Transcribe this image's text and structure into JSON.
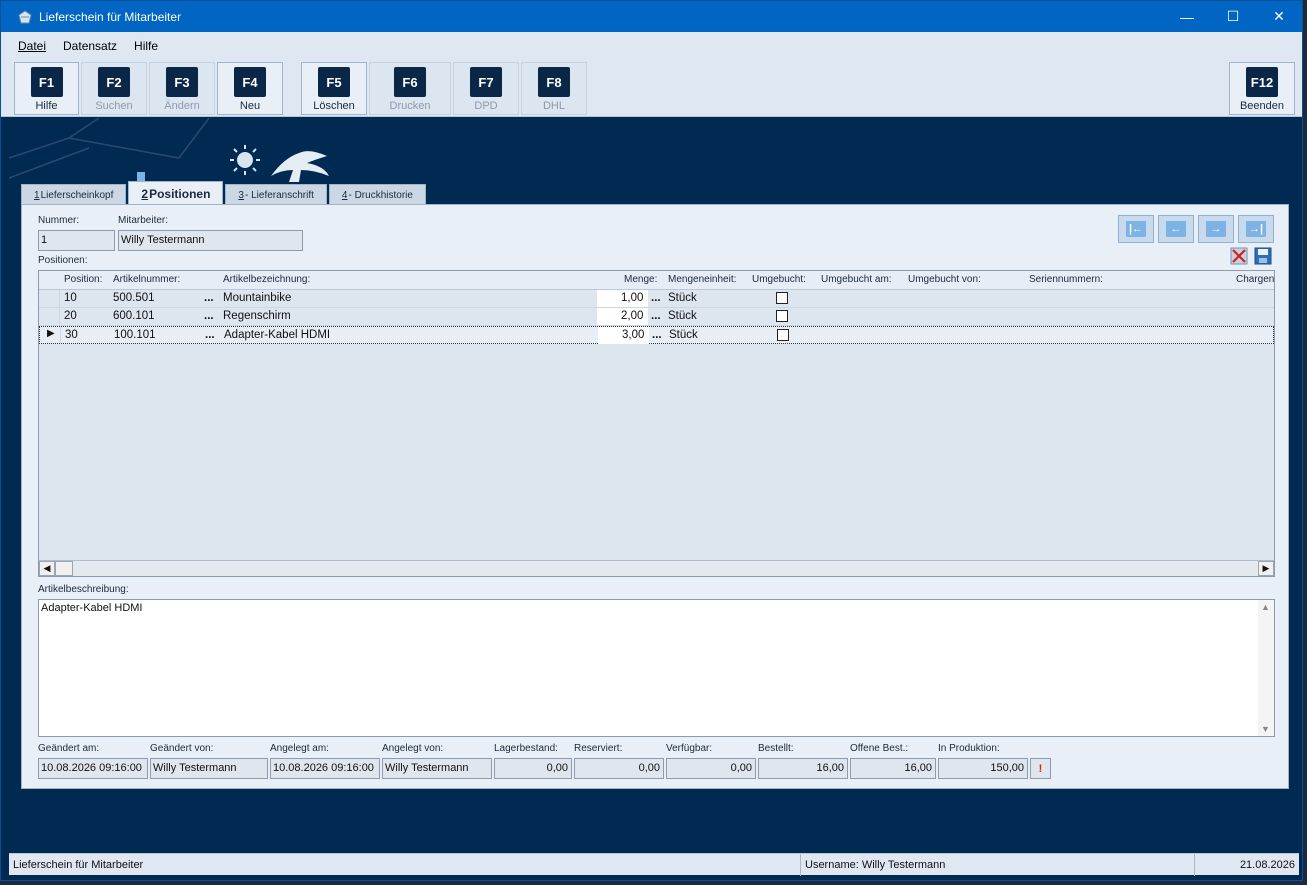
{
  "window": {
    "title": "Lieferschein für Mitarbeiter"
  },
  "menu": [
    "Datei",
    "Datensatz",
    "Hilfe"
  ],
  "fkeys": [
    {
      "key": "F1",
      "label": "Hilfe"
    },
    {
      "key": "F2",
      "label": "Suchen"
    },
    {
      "key": "F3",
      "label": "Ändern"
    },
    {
      "key": "F4",
      "label": "Neu"
    },
    {
      "key": "F5",
      "label": "Löschen"
    },
    {
      "key": "F6",
      "label": "Drucken"
    },
    {
      "key": "F7",
      "label": "DPD"
    },
    {
      "key": "F8",
      "label": "DHL"
    },
    {
      "key": "F12",
      "label": "Beenden"
    }
  ],
  "tabs": [
    {
      "num": "1",
      "label": " Lieferscheinkopf"
    },
    {
      "num": "2",
      "label": " Positionen"
    },
    {
      "num": "3",
      "label": " - Lieferanschrift"
    },
    {
      "num": "4",
      "label": " - Druckhistorie"
    }
  ],
  "header": {
    "nummer_label": "Nummer:",
    "nummer": "1",
    "mitarbeiter_label": "Mitarbeiter:",
    "mitarbeiter": "Willy Testermann",
    "positionen_label": "Positionen:"
  },
  "grid": {
    "columns": [
      "Position:",
      "Artikelnummer:",
      "Artikelbezeichnung:",
      "Menge:",
      "Mengeneinheit:",
      "Umgebucht:",
      "Umgebucht am:",
      "Umgebucht von:",
      "Seriennummern:",
      "Chargen"
    ],
    "rows": [
      {
        "pos": "10",
        "artnr": "500.501",
        "bez": "Mountainbike",
        "menge": "1,00",
        "einheit": "Stück"
      },
      {
        "pos": "20",
        "artnr": "600.101",
        "bez": "Regenschirm",
        "menge": "2,00",
        "einheit": "Stück"
      },
      {
        "pos": "30",
        "artnr": "100.101",
        "bez": "Adapter-Kabel HDMI",
        "menge": "3,00",
        "einheit": "Stück"
      }
    ],
    "ellipsis": "..."
  },
  "description": {
    "label": "Artikelbeschreibung:",
    "text": "Adapter-Kabel HDMI"
  },
  "footer": {
    "geaendert_am_label": "Geändert am:",
    "geaendert_am": "10.08.2026 09:16:00",
    "geaendert_von_label": "Geändert von:",
    "geaendert_von": "Willy Testermann",
    "angelegt_am_label": "Angelegt am:",
    "angelegt_am": "10.08.2026 09:16:00",
    "angelegt_von_label": "Angelegt von:",
    "angelegt_von": "Willy Testermann",
    "lagerbestand_label": "Lagerbestand:",
    "lagerbestand": "0,00",
    "reserviert_label": "Reserviert:",
    "reserviert": "0,00",
    "verfuegbar_label": "Verfügbar:",
    "verfuegbar": "0,00",
    "bestellt_label": "Bestellt:",
    "bestellt": "16,00",
    "offene_label": "Offene Best.:",
    "offene": "16,00",
    "produktion_label": "In Produktion:",
    "produktion": "150,00",
    "excl": "!"
  },
  "status": {
    "left": "Lieferschein für Mitarbeiter",
    "user": "Username: Willy Testermann",
    "date": "21.08.2026"
  },
  "colors": {
    "titlebar": "#0065c3",
    "background": "#002a52",
    "panel": "#e9eff6"
  }
}
